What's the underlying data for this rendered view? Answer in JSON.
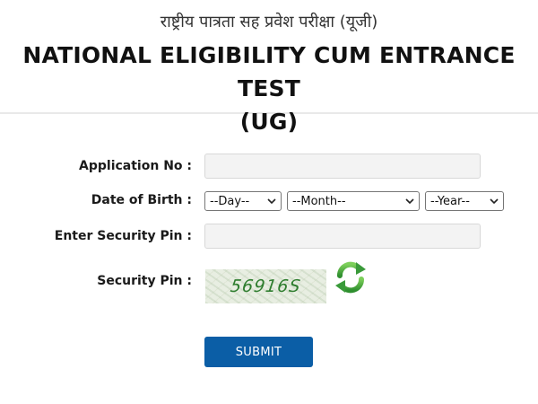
{
  "header": {
    "hindi_title": "राष्ट्रीय पात्रता सह प्रवेश परीक्षा (यूजी)",
    "title_line1": "NATIONAL ELIGIBILITY CUM ENTRANCE TEST",
    "title_line2": "(UG)"
  },
  "form": {
    "application_no": {
      "label": "Application No :",
      "value": "",
      "placeholder": ""
    },
    "date_of_birth": {
      "label": "Date of Birth :",
      "day": "--Day--",
      "month": "--Month--",
      "year": "--Year--"
    },
    "security_pin_input": {
      "label": "Enter Security Pin :",
      "value": "",
      "placeholder": ""
    },
    "security_pin": {
      "label": "Security Pin :",
      "captcha": "56916S"
    },
    "submit_label": "SUBMIT"
  },
  "colors": {
    "submit_bg": "#0b5ea6",
    "captcha_text": "#2e7d2e",
    "refresh_icon": "#3a9a3a"
  }
}
